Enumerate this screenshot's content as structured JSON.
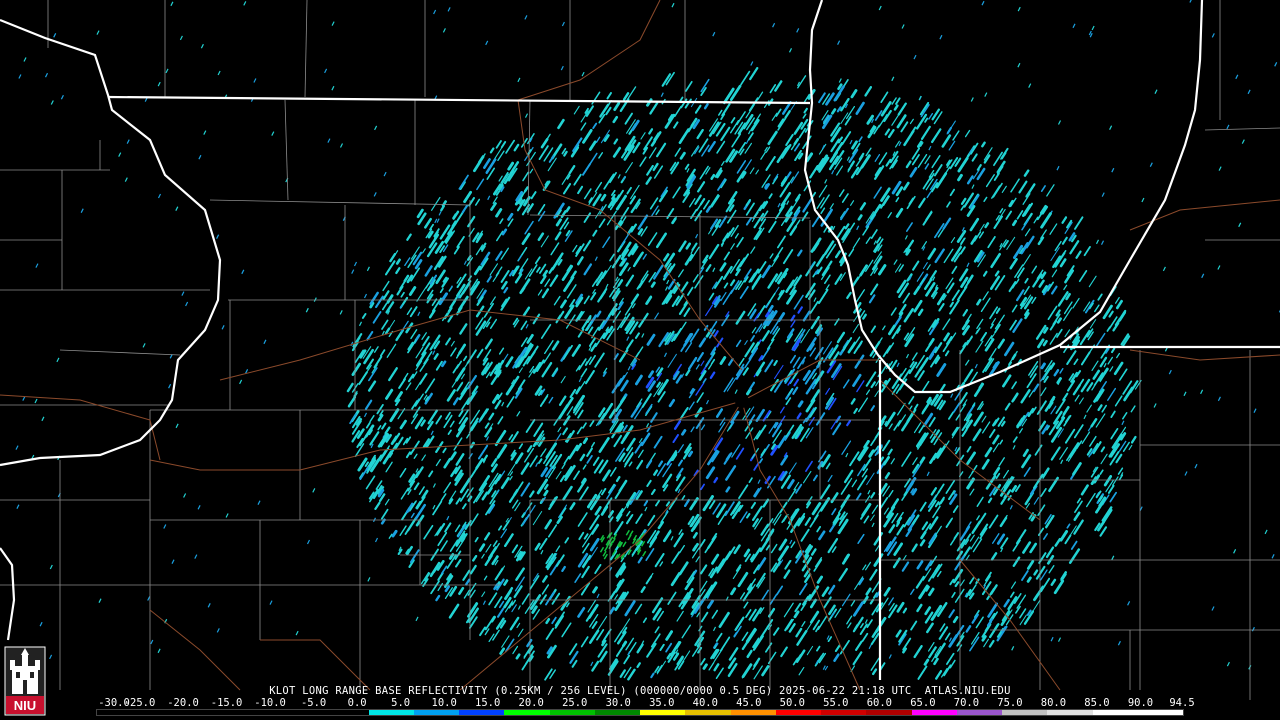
{
  "product": {
    "caption": "KLOT LONG RANGE BASE REFLECTIVITY (0.25KM / 256 LEVEL) (000000/0000 0.5 DEG) 2025-06-22 21:18 UTC  ATLAS.NIU.EDU"
  },
  "legend": {
    "labels": [
      "-30.0",
      "-25.0",
      "-20.0",
      "-15.0",
      "-10.0",
      "-5.0",
      "0.0",
      "5.0",
      "10.0",
      "15.0",
      "20.0",
      "25.0",
      "30.0",
      "35.0",
      "40.0",
      "45.0",
      "50.0",
      "55.0",
      "60.0",
      "65.0",
      "70.0",
      "75.0",
      "80.0",
      "85.0",
      "90.0",
      "94.5"
    ],
    "colors": [
      "#000000",
      "#000000",
      "#000000",
      "#000000",
      "#000000",
      "#000000",
      "#00e6e6",
      "#00a0f0",
      "#0040ff",
      "#00ff00",
      "#00c000",
      "#008800",
      "#ffff00",
      "#e6c000",
      "#ff9000",
      "#ff0000",
      "#d00000",
      "#b00000",
      "#ff00ff",
      "#9955cc",
      "#c0c0c0",
      "#e0e0e0",
      "#ffffff",
      "#ffffff"
    ]
  },
  "logo": {
    "text": "NIU"
  },
  "colors": {
    "background": "#000000",
    "state_borders": "#ffffff",
    "county_borders": "#8c8c8c",
    "highways": "#8b4a2b",
    "echo_light": "#22d3d3",
    "echo_medium": "#1aa0e0",
    "echo_strong": "#2050ff",
    "echo_green": "#10c040"
  },
  "radar": {
    "site": "KLOT"
  }
}
